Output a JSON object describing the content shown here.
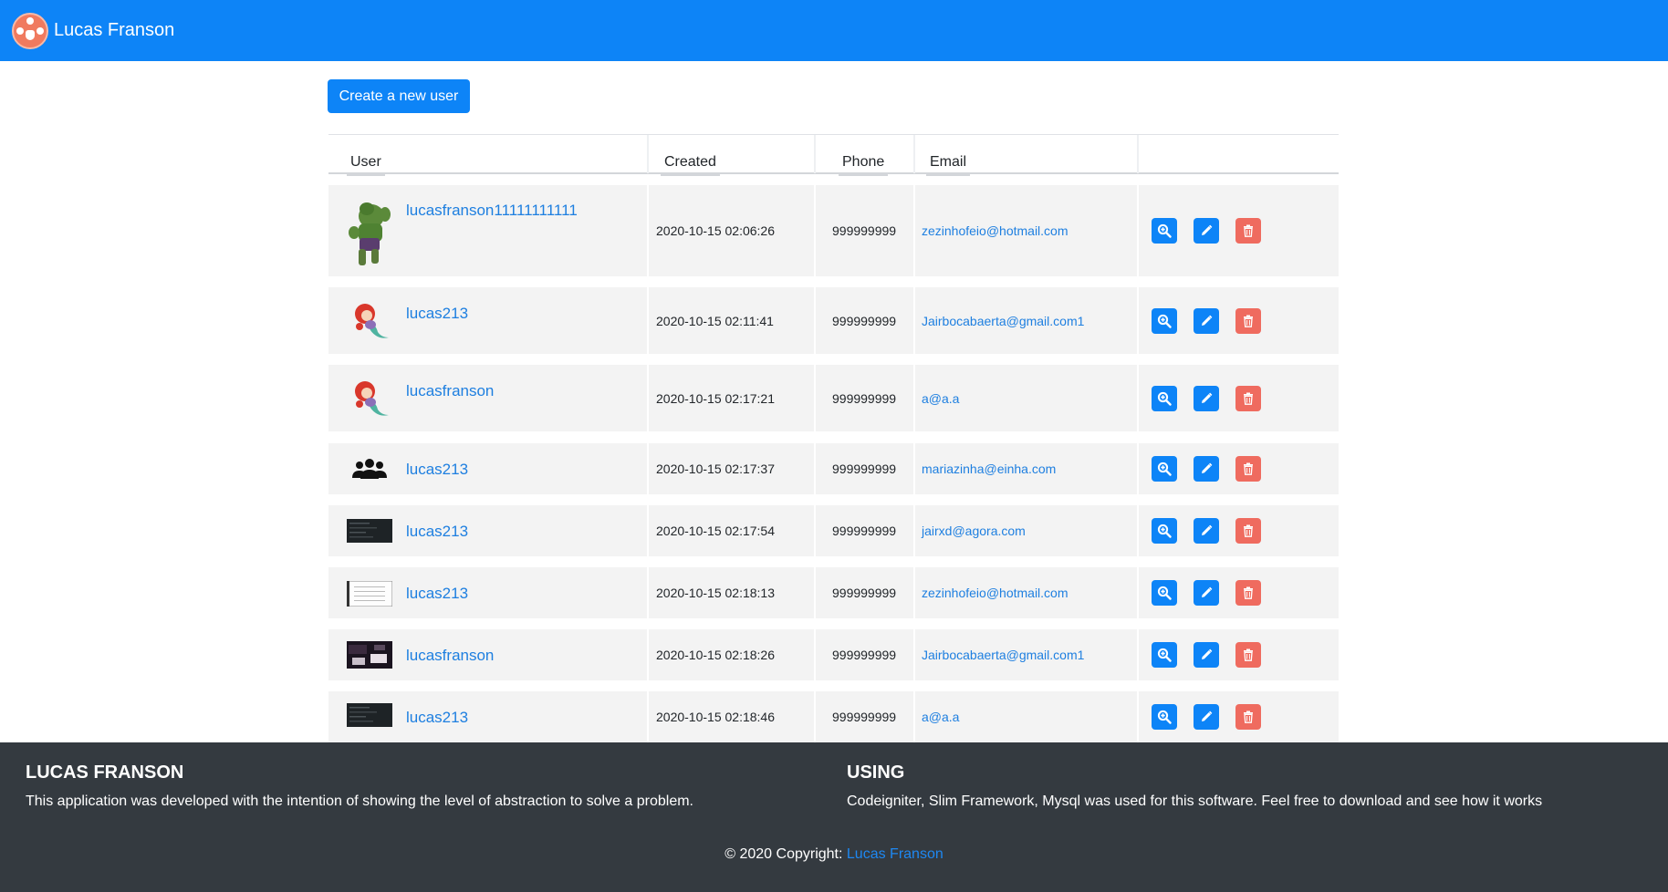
{
  "header": {
    "brand": "Lucas Franson",
    "logo_icon": "logo-icon"
  },
  "toolbar": {
    "create_label": "Create a new user"
  },
  "table": {
    "columns": [
      "User",
      "Created",
      "Phone",
      "Email"
    ],
    "rows": [
      {
        "user": "lucasfranson11111111111",
        "avatar": "hulk-avatar",
        "created": "2020-10-15 02:06:26",
        "phone": "999999999",
        "email": "zezinhofeio@hotmail.com"
      },
      {
        "user": "lucas213",
        "avatar": "mermaid-avatar",
        "created": "2020-10-15 02:11:41",
        "phone": "999999999",
        "email": "Jairbocabaerta@gmail.com1"
      },
      {
        "user": "lucasfranson",
        "avatar": "mermaid-avatar",
        "created": "2020-10-15 02:17:21",
        "phone": "999999999",
        "email": "a@a.a"
      },
      {
        "user": "lucas213",
        "avatar": "users-group-avatar",
        "created": "2020-10-15 02:17:37",
        "phone": "999999999",
        "email": "mariazinha@einha.com"
      },
      {
        "user": "lucas213",
        "avatar": "dark-screenshot-avatar",
        "created": "2020-10-15 02:17:54",
        "phone": "999999999",
        "email": "jairxd@agora.com"
      },
      {
        "user": "lucas213",
        "avatar": "light-screenshot-avatar",
        "created": "2020-10-15 02:18:13",
        "phone": "999999999",
        "email": "zezinhofeio@hotmail.com"
      },
      {
        "user": "lucasfranson",
        "avatar": "dark-photo-avatar",
        "created": "2020-10-15 02:18:26",
        "phone": "999999999",
        "email": "Jairbocabaerta@gmail.com1"
      },
      {
        "user": "lucas213",
        "avatar": "dark-screenshot-avatar",
        "created": "2020-10-15 02:18:46",
        "phone": "999999999",
        "email": "a@a.a"
      }
    ],
    "actions": [
      "zoom-in-icon",
      "pencil-icon",
      "trash-icon"
    ]
  },
  "footer": {
    "left_title": "LUCAS FRANSON",
    "left_text": "This application was developed with the intention of showing the level of abstraction to solve a problem.",
    "right_title": "USING",
    "right_text": "Codeigniter, Slim Framework, Mysql was used for this software. Feel free to download and see how it works",
    "copyright_prefix": "© 2020 Copyright:",
    "copyright_link": "Lucas Franson"
  },
  "colors": {
    "primary": "#0d84f7",
    "danger": "#ef6b5f",
    "footer_bg": "#343a40",
    "row_bg": "#f3f3f3",
    "link": "#1e7fe0"
  }
}
